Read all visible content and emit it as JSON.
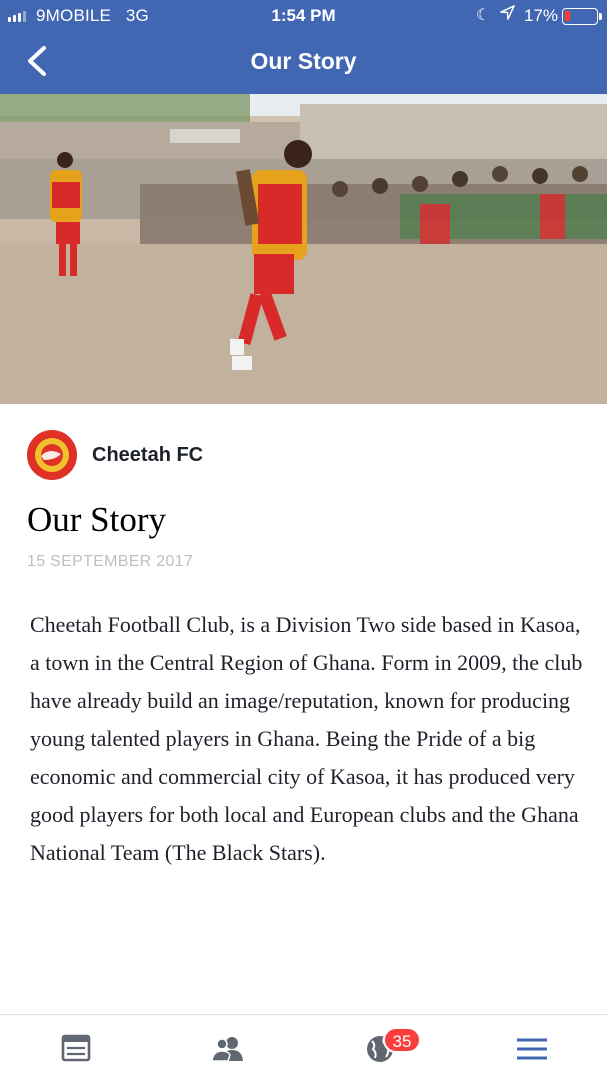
{
  "status_bar": {
    "carrier": "9MOBILE",
    "network": "3G",
    "time": "1:54 PM",
    "battery": "17%",
    "battery_level": 0.17,
    "icons": [
      "signal-icon",
      "moon-icon",
      "location-arrow-icon",
      "battery-icon"
    ]
  },
  "nav": {
    "title": "Our Story",
    "back_icon": "chevron-left-icon"
  },
  "colors": {
    "brand_blue": "#4267b2",
    "badge_red": "#fa3e3e",
    "icon_gray": "#606770",
    "active_blue": "#4267b2"
  },
  "article": {
    "page_name": "Cheetah FC",
    "title": "Our Story",
    "date": "15 SEPTEMBER 2017",
    "body": "Cheetah Football Club, is a Division Two side based in Kasoa, a town in the Central Region of Ghana. Form in 2009, the club have already build an image/reputation, known for producing young talented players in Ghana. Being the Pride of a big economic and commercial city of Kasoa, it has produced very good players for both local and European clubs and the Ghana National Team (The Black Stars)."
  },
  "tabbar": {
    "tabs": [
      {
        "icon": "news-feed-icon"
      },
      {
        "icon": "friends-icon"
      },
      {
        "icon": "globe-notifications-icon"
      },
      {
        "icon": "menu-icon"
      }
    ],
    "notifications_badge": "35"
  }
}
